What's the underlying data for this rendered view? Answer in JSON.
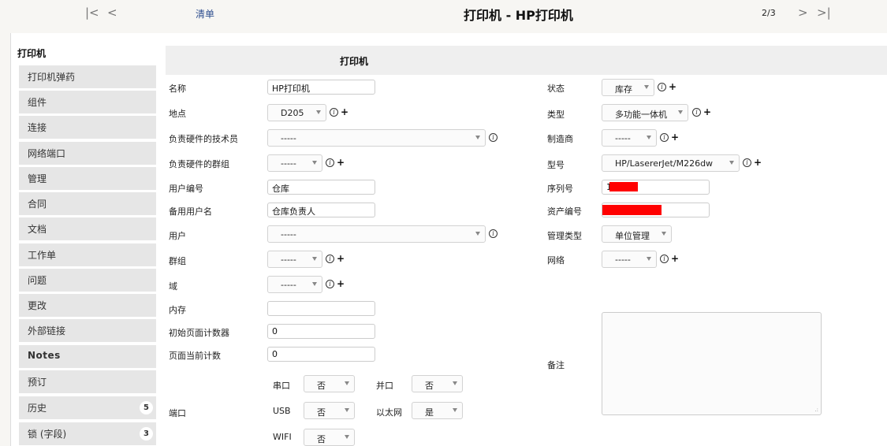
{
  "header": {
    "first_icon": "first-page-icon",
    "prev_icon": "previous-icon",
    "list_link": "清单",
    "title": "打印机 - HP打印机",
    "pager": "2/3",
    "next_icon": "next-icon",
    "last_icon": "last-page-icon"
  },
  "tabs": {
    "active": "打印机",
    "items": [
      {
        "label": "打印机弹药"
      },
      {
        "label": "组件"
      },
      {
        "label": "连接"
      },
      {
        "label": "网络端口"
      },
      {
        "label": "管理"
      },
      {
        "label": "合同"
      },
      {
        "label": "文档"
      },
      {
        "label": "工作单"
      },
      {
        "label": "问题"
      },
      {
        "label": "更改"
      },
      {
        "label": "外部链接"
      },
      {
        "label": "Notes"
      },
      {
        "label": "预订"
      },
      {
        "label": "历史",
        "badge": "5"
      },
      {
        "label": "锁 (字段)",
        "badge": "3"
      }
    ]
  },
  "form": {
    "section_title": "打印机",
    "left": {
      "name": {
        "label": "名称",
        "value": "HP打印机"
      },
      "location": {
        "label": "地点",
        "value": "D205"
      },
      "tech_user": {
        "label": "负责硬件的技术员",
        "value": "-----"
      },
      "tech_group": {
        "label": "负责硬件的群组",
        "value": "-----"
      },
      "user_number": {
        "label": "用户编号",
        "value": "仓库"
      },
      "alt_username": {
        "label": "备用用户名",
        "value": "仓库负责人"
      },
      "user": {
        "label": "用户",
        "value": "-----"
      },
      "group": {
        "label": "群组",
        "value": "-----"
      },
      "domain": {
        "label": "域",
        "value": "-----"
      },
      "memory": {
        "label": "内存",
        "value": ""
      },
      "init_counter": {
        "label": "初始页面计数器",
        "value": "0"
      },
      "current_counter": {
        "label": "页面当前计数",
        "value": "0"
      },
      "ports": {
        "label": "端口",
        "serial": {
          "label": "串口",
          "value": "否"
        },
        "parallel": {
          "label": "并口",
          "value": "否"
        },
        "usb": {
          "label": "USB",
          "value": "否"
        },
        "ethernet": {
          "label": "以太网",
          "value": "是"
        },
        "wifi": {
          "label": "WIFI",
          "value": "否"
        }
      }
    },
    "right": {
      "status": {
        "label": "状态",
        "value": "库存"
      },
      "type": {
        "label": "类型",
        "value": "多功能一体机"
      },
      "manufacturer": {
        "label": "制造商",
        "value": "-----"
      },
      "model": {
        "label": "型号",
        "value": "HP/LasererJet/M226dw"
      },
      "serial": {
        "label": "序列号",
        "value": "1"
      },
      "inventory": {
        "label": "资产编号",
        "value": ""
      },
      "management_type": {
        "label": "管理类型",
        "value": "单位管理"
      },
      "network": {
        "label": "网络",
        "value": "-----"
      },
      "comments": {
        "label": "备注",
        "value": ""
      }
    }
  }
}
